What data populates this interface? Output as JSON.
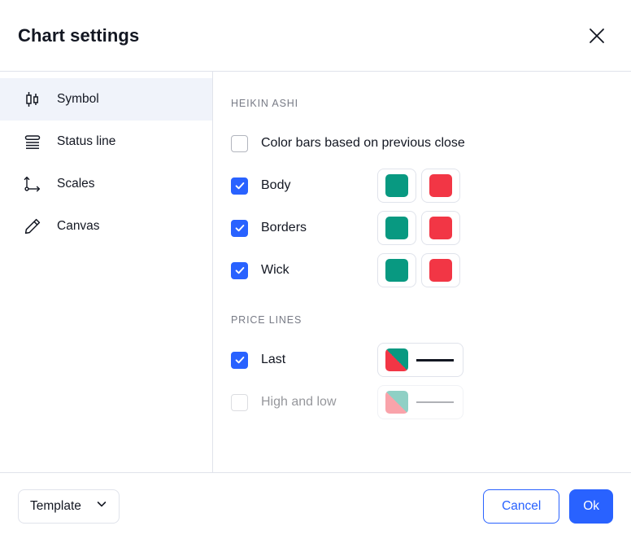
{
  "header": {
    "title": "Chart settings",
    "close_icon": "close-icon"
  },
  "sidebar": {
    "items": [
      {
        "label": "Symbol",
        "icon": "candlestick-icon",
        "active": true
      },
      {
        "label": "Status line",
        "icon": "status-line-icon",
        "active": false
      },
      {
        "label": "Scales",
        "icon": "axes-icon",
        "active": false
      },
      {
        "label": "Canvas",
        "icon": "pencil-icon",
        "active": false
      }
    ]
  },
  "content": {
    "sections": [
      {
        "title": "HEIKIN ASHI",
        "rows": [
          {
            "label": "Color bars based on previous close",
            "checked": false,
            "controls": "none"
          },
          {
            "label": "Body",
            "checked": true,
            "controls": "two-swatches",
            "up_color": "#089981",
            "down_color": "#f23645"
          },
          {
            "label": "Borders",
            "checked": true,
            "controls": "two-swatches",
            "up_color": "#089981",
            "down_color": "#f23645"
          },
          {
            "label": "Wick",
            "checked": true,
            "controls": "two-swatches",
            "up_color": "#089981",
            "down_color": "#f23645"
          }
        ]
      },
      {
        "title": "PRICE LINES",
        "rows": [
          {
            "label": "Last",
            "checked": true,
            "controls": "split-swatch-line",
            "up_color": "#089981",
            "down_color": "#f23645",
            "line_color": "#131722"
          },
          {
            "label": "High and low",
            "checked": false,
            "controls": "split-swatch-line",
            "up_color": "#089981",
            "down_color": "#f23645",
            "line_color": "#50535e",
            "faded": true
          }
        ]
      }
    ]
  },
  "footer": {
    "template_label": "Template",
    "template_chevron": "chevron-down-icon",
    "cancel_label": "Cancel",
    "ok_label": "Ok"
  },
  "colors": {
    "accent": "#2962ff",
    "up": "#089981",
    "down": "#f23645",
    "text": "#131722",
    "muted": "#787b86",
    "border": "#e0e3eb",
    "active_bg": "#f0f3fa"
  }
}
